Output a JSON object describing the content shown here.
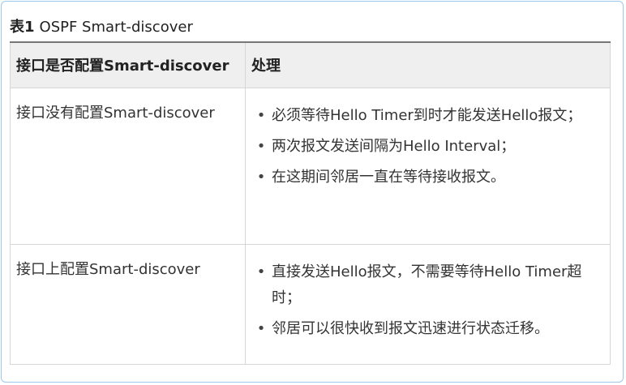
{
  "caption": {
    "number": "表1",
    "title": "OSPF Smart-discover"
  },
  "table": {
    "headers": [
      "接口是否配置Smart-discover",
      "处理"
    ],
    "rows": [
      {
        "condition": "接口没有配置Smart-discover",
        "items": [
          "必须等待Hello Timer到时才能发送Hello报文；",
          "两次报文发送间隔为Hello Interval；",
          "在这期间邻居一直在等待接收报文。"
        ]
      },
      {
        "condition": "接口上配置Smart-discover",
        "items": [
          "直接发送Hello报文，不需要等待Hello Timer超时；",
          "邻居可以很快收到报文迅速进行状态迁移。"
        ]
      }
    ]
  },
  "bullet_glyph": "•",
  "colors": {
    "frame_border": "#9ec7ea",
    "header_background": "#efefef",
    "header_top_rule": "#777777",
    "cell_border": "#d6d6d6"
  }
}
